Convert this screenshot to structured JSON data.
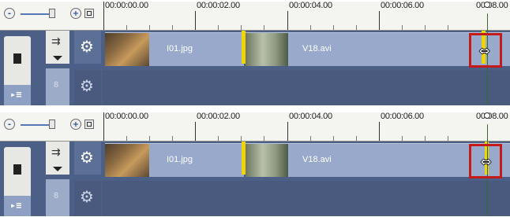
{
  "panels": [
    {
      "ruler": {
        "ticks": [
          "00:00:00.00",
          "00:00:02.00",
          "00:00:04.00",
          "00:00:06.00",
          "00:08.00"
        ]
      },
      "tracks": {
        "video_clips": [
          {
            "name": "I01.jpg"
          },
          {
            "name": "V18.avi"
          }
        ],
        "overlay_locked_label": "8"
      },
      "zoom": {
        "out_icon": "zoom-out-icon",
        "in_icon": "zoom-in-icon",
        "fit_icon": "fit-to-window-icon"
      },
      "cursor": {
        "icon": "resize-horizontal-cursor-icon"
      }
    },
    {
      "ruler": {
        "ticks": [
          "00:00:00.00",
          "00:00:02.00",
          "00:00:04.00",
          "00:00:06.00",
          "00:08.00"
        ]
      },
      "tracks": {
        "video_clips": [
          {
            "name": "I01.jpg"
          },
          {
            "name": "V18.avi"
          }
        ],
        "overlay_locked_label": "8"
      },
      "zoom": {
        "out_icon": "zoom-out-icon",
        "in_icon": "zoom-in-icon",
        "fit_icon": "fit-to-window-icon"
      },
      "cursor": {
        "icon": "resize-horizontal-cursor-icon"
      }
    }
  ],
  "colors": {
    "highlight": "#c41a18",
    "clip": "#98a9cc",
    "trim_marker": "#f2d400",
    "track_bg": "#4c5f86"
  }
}
